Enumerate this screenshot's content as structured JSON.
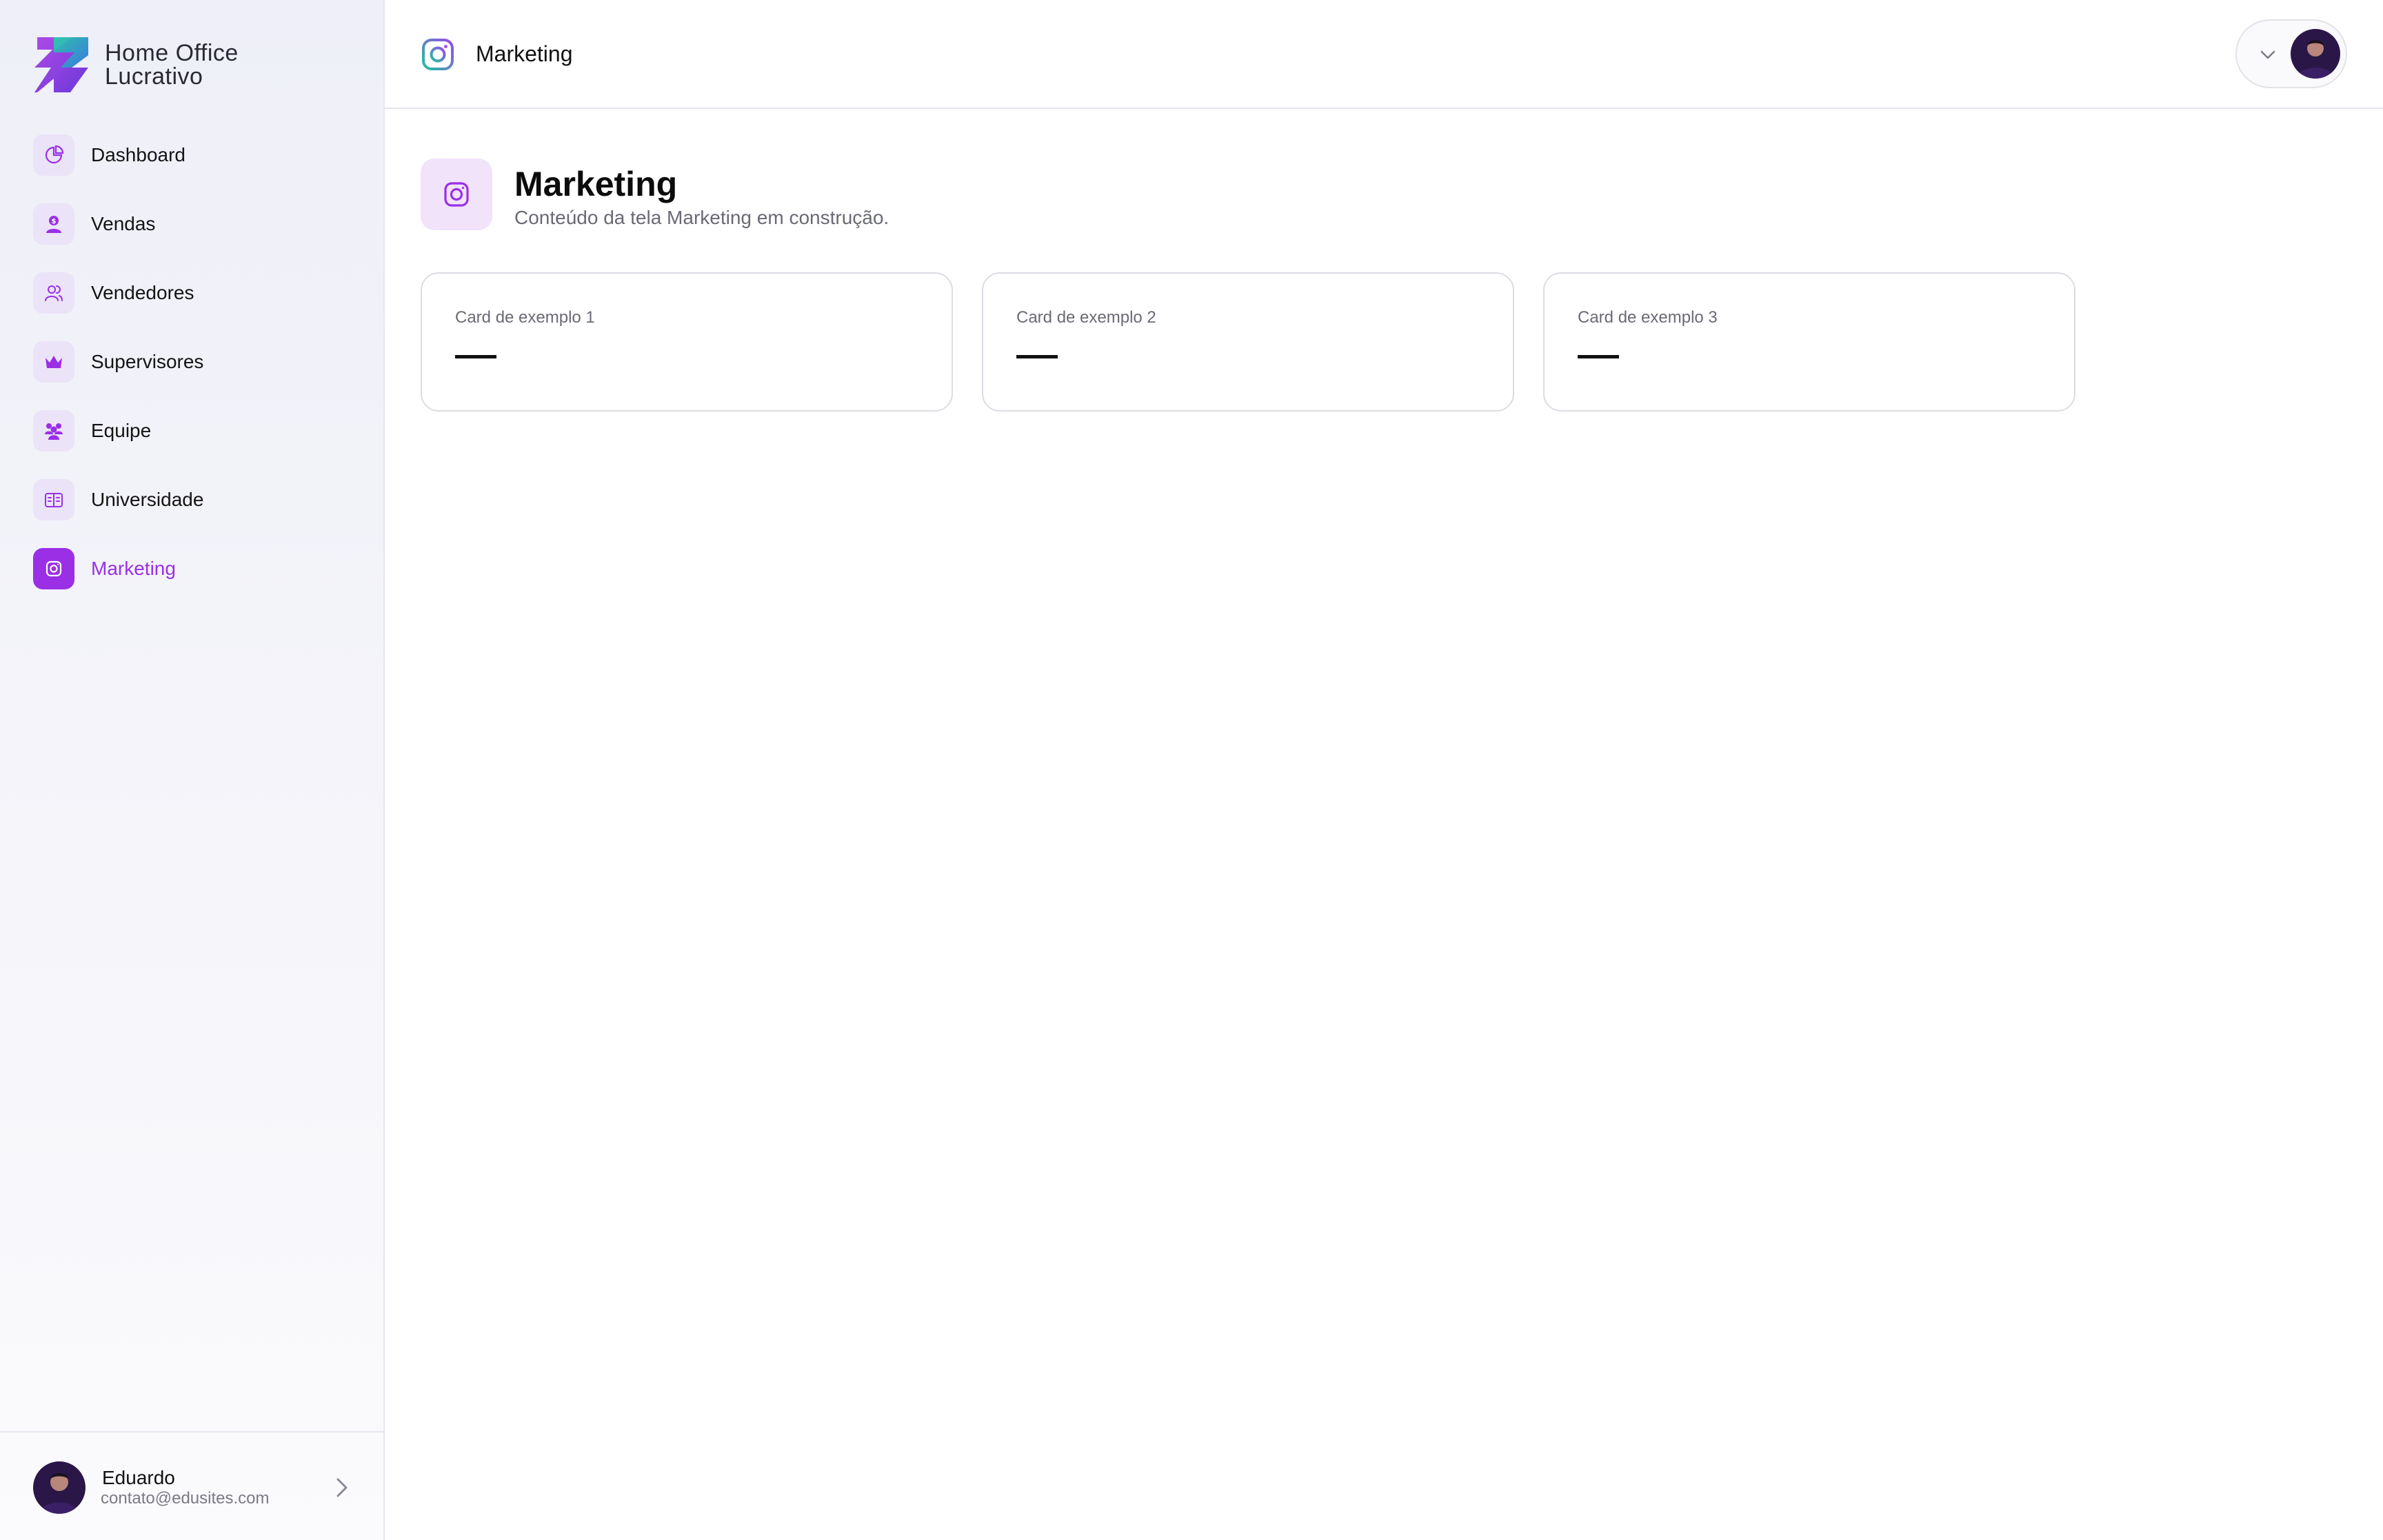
{
  "brand": {
    "line1": "Home Office",
    "line2": "Lucrativo"
  },
  "sidebar": {
    "items": [
      {
        "label": "Dashboard",
        "icon": "chart-pie-icon",
        "active": false
      },
      {
        "label": "Vendas",
        "icon": "sales-person-icon",
        "active": false
      },
      {
        "label": "Vendedores",
        "icon": "users-icon",
        "active": false
      },
      {
        "label": "Supervisores",
        "icon": "crown-icon",
        "active": false
      },
      {
        "label": "Equipe",
        "icon": "team-icon",
        "active": false
      },
      {
        "label": "Universidade",
        "icon": "book-icon",
        "active": false
      },
      {
        "label": "Marketing",
        "icon": "instagram-icon",
        "active": true
      }
    ]
  },
  "user": {
    "name": "Eduardo",
    "email": "contato@edusites.com"
  },
  "topbar": {
    "title": "Marketing"
  },
  "page": {
    "title": "Marketing",
    "subtitle": "Conteúdo da tela Marketing em construção."
  },
  "cards": [
    {
      "label": "Card de exemplo 1",
      "value": "—"
    },
    {
      "label": "Card de exemplo 2",
      "value": "—"
    },
    {
      "label": "Card de exemplo 3",
      "value": "—"
    }
  ],
  "colors": {
    "accent": "#9a2fe6",
    "accent_light": "#ebe3f8",
    "border": "#dcdce4"
  }
}
